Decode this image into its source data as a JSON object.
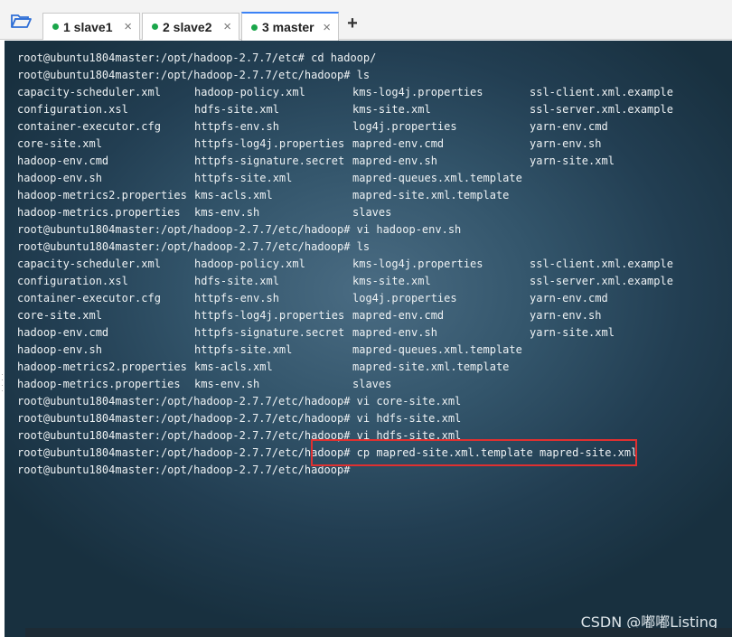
{
  "tabs": [
    {
      "label": "1 slave1",
      "close": "×"
    },
    {
      "label": "2 slave2",
      "close": "×"
    },
    {
      "label": "3 master",
      "close": "×"
    }
  ],
  "add_tab": "+",
  "terminal": {
    "lines": [
      {
        "type": "cmd",
        "text": "root@ubuntu1804master:/opt/hadoop-2.7.7/etc# cd hadoop/"
      },
      {
        "type": "cmd",
        "text": "root@ubuntu1804master:/opt/hadoop-2.7.7/etc/hadoop# ls"
      },
      {
        "type": "ls",
        "cols": [
          "capacity-scheduler.xml",
          "hadoop-policy.xml",
          "kms-log4j.properties",
          "ssl-client.xml.example"
        ]
      },
      {
        "type": "ls",
        "cols": [
          "configuration.xsl",
          "hdfs-site.xml",
          "kms-site.xml",
          "ssl-server.xml.example"
        ]
      },
      {
        "type": "ls",
        "cols": [
          "container-executor.cfg",
          "httpfs-env.sh",
          "log4j.properties",
          "yarn-env.cmd"
        ]
      },
      {
        "type": "ls",
        "cols": [
          "core-site.xml",
          "httpfs-log4j.properties",
          "mapred-env.cmd",
          "yarn-env.sh"
        ]
      },
      {
        "type": "ls",
        "cols": [
          "hadoop-env.cmd",
          "httpfs-signature.secret",
          "mapred-env.sh",
          "yarn-site.xml"
        ]
      },
      {
        "type": "ls",
        "cols": [
          "hadoop-env.sh",
          "httpfs-site.xml",
          "mapred-queues.xml.template",
          ""
        ]
      },
      {
        "type": "ls",
        "cols": [
          "hadoop-metrics2.properties",
          "kms-acls.xml",
          "mapred-site.xml.template",
          ""
        ]
      },
      {
        "type": "ls",
        "cols": [
          "hadoop-metrics.properties",
          "kms-env.sh",
          "slaves",
          ""
        ]
      },
      {
        "type": "cmd",
        "text": "root@ubuntu1804master:/opt/hadoop-2.7.7/etc/hadoop# vi hadoop-env.sh"
      },
      {
        "type": "cmd",
        "text": "root@ubuntu1804master:/opt/hadoop-2.7.7/etc/hadoop# ls"
      },
      {
        "type": "ls",
        "cols": [
          "capacity-scheduler.xml",
          "hadoop-policy.xml",
          "kms-log4j.properties",
          "ssl-client.xml.example"
        ]
      },
      {
        "type": "ls",
        "cols": [
          "configuration.xsl",
          "hdfs-site.xml",
          "kms-site.xml",
          "ssl-server.xml.example"
        ]
      },
      {
        "type": "ls",
        "cols": [
          "container-executor.cfg",
          "httpfs-env.sh",
          "log4j.properties",
          "yarn-env.cmd"
        ]
      },
      {
        "type": "ls",
        "cols": [
          "core-site.xml",
          "httpfs-log4j.properties",
          "mapred-env.cmd",
          "yarn-env.sh"
        ]
      },
      {
        "type": "ls",
        "cols": [
          "hadoop-env.cmd",
          "httpfs-signature.secret",
          "mapred-env.sh",
          "yarn-site.xml"
        ]
      },
      {
        "type": "ls",
        "cols": [
          "hadoop-env.sh",
          "httpfs-site.xml",
          "mapred-queues.xml.template",
          ""
        ]
      },
      {
        "type": "ls",
        "cols": [
          "hadoop-metrics2.properties",
          "kms-acls.xml",
          "mapred-site.xml.template",
          ""
        ]
      },
      {
        "type": "ls",
        "cols": [
          "hadoop-metrics.properties",
          "kms-env.sh",
          "slaves",
          ""
        ]
      },
      {
        "type": "cmd",
        "text": "root@ubuntu1804master:/opt/hadoop-2.7.7/etc/hadoop# vi core-site.xml"
      },
      {
        "type": "cmd",
        "text": "root@ubuntu1804master:/opt/hadoop-2.7.7/etc/hadoop# vi hdfs-site.xml"
      },
      {
        "type": "cmd",
        "text": "root@ubuntu1804master:/opt/hadoop-2.7.7/etc/hadoop# vi hdfs-site.xml"
      },
      {
        "type": "cmd",
        "text": "root@ubuntu1804master:/opt/hadoop-2.7.7/etc/hadoop# cp mapred-site.xml.template mapred-site.xml"
      },
      {
        "type": "cmd",
        "text": "root@ubuntu1804master:/opt/hadoop-2.7.7/etc/hadoop#"
      }
    ]
  },
  "watermark": "CSDN @嘟嘟Listing",
  "colors": {
    "terminal_bg": "#2c4a5e",
    "terminal_text": "#eef2f4",
    "highlight_border": "#e03030",
    "tab_dot": "#1aa64a",
    "active_tab_accent": "#3b82f6",
    "folder_icon": "#2f6fd6"
  },
  "icons": {
    "folder": "folder-open-icon",
    "close": "close-icon",
    "add": "plus-icon"
  }
}
